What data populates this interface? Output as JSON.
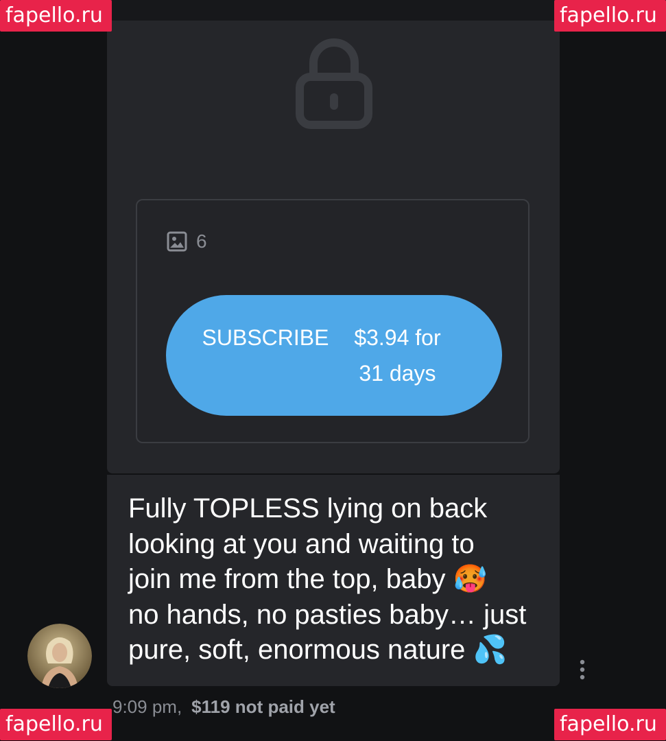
{
  "watermark": {
    "text": "fapello.ru",
    "color": "#e8234a"
  },
  "locked_post": {
    "lock_icon": "lock-icon",
    "media": {
      "icon": "image-icon",
      "count": "6"
    },
    "subscribe": {
      "label": "SUBSCRIBE",
      "price_line1": "$3.94 for",
      "price_line2": "31 days",
      "color": "#4fa8e8"
    }
  },
  "message": {
    "lines": [
      "Fully TOPLESS lying on back",
      "looking at you and waiting to",
      "join me from the top, baby 🥵",
      "no hands, no pasties baby… just",
      "pure, soft, enormous nature 💦"
    ],
    "time": "9:09 pm,",
    "price_status": "$119 not paid yet"
  },
  "avatar": {
    "icon": "avatar"
  },
  "more_menu": {
    "icon": "more-vertical-icon"
  }
}
